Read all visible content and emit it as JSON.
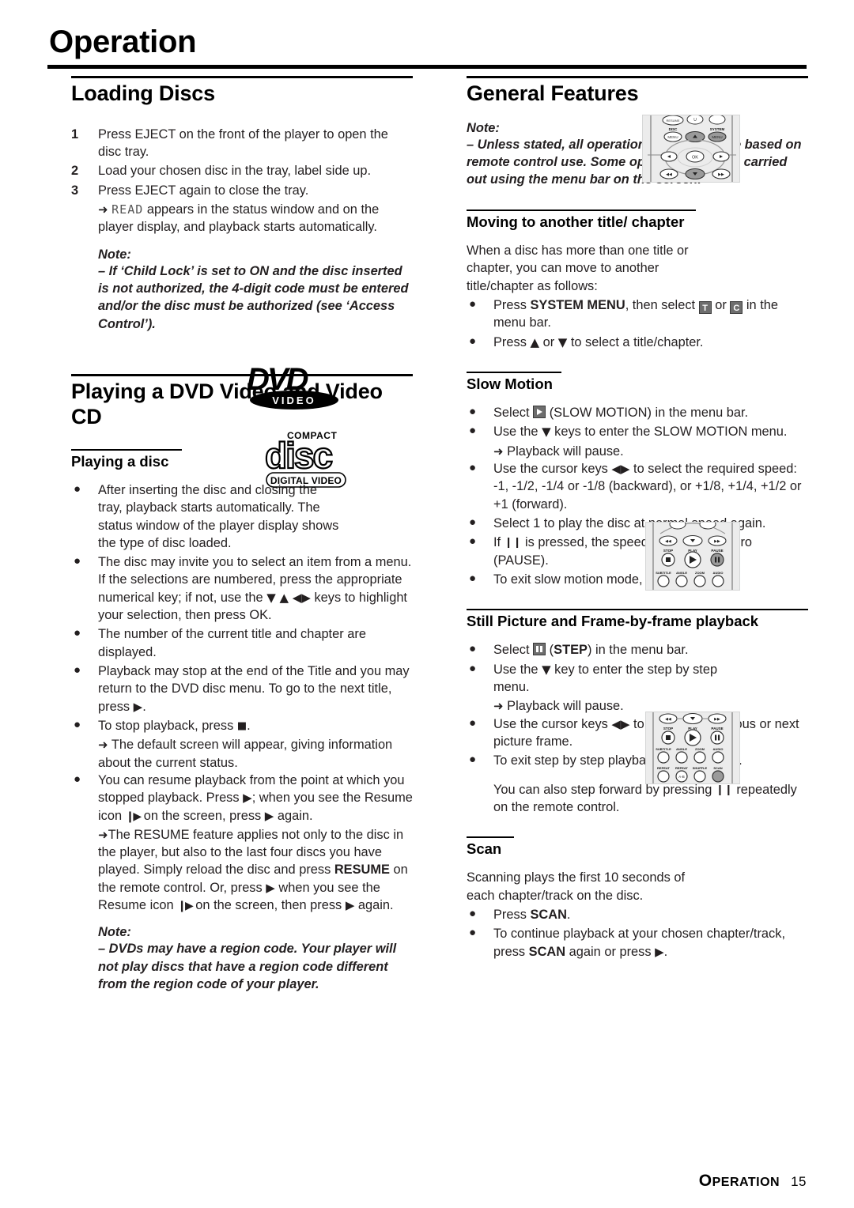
{
  "page": {
    "title": "Operation",
    "footer_section": "OPERATION",
    "footer_page": "15"
  },
  "left_column": {
    "loading_discs": {
      "heading": "Loading Discs",
      "steps": [
        {
          "num": "1",
          "text": "Press EJECT on the front of the player to open the disc tray."
        },
        {
          "num": "2",
          "text": "Load your chosen disc in the tray, label side up."
        },
        {
          "num": "3",
          "text": "Press EJECT again to close the tray."
        }
      ],
      "step3_result_prefix": "appears in the status window and on the player display, and playback starts automatically.",
      "lcd_text": "READ",
      "note_label": "Note:",
      "note_text": "–  If ‘Child Lock’ is set to ON and the disc inserted is not authorized, the 4-digit code must be entered and/or the disc must be authorized (see ‘Access Control’)."
    },
    "playing_dvd": {
      "heading": "Playing a DVD Video and Video CD",
      "subheading": "Playing a disc",
      "bullet1": "After inserting the disc and closing the tray, playback starts automatically. The status window of the player display shows the type of disc loaded.",
      "bullet2_a": "The disc may invite you to select an item from a menu. If the selections are numbered, press the appropriate numerical key; if not, use the",
      "bullet2_b": "keys to highlight your selection, then press OK.",
      "bullet3": "The number of the current title and chapter are displayed.",
      "bullet4_a": "Playback may stop at the end of the Title and you may return to the DVD disc menu. To go to the next title, press",
      "bullet5_a": "To stop playback, press",
      "bullet5_result": "The default screen will appear, giving information about the current status.",
      "bullet6_a": "You can resume playback from the point at which you stopped playback. Press",
      "bullet6_b": "; when you see the Resume icon",
      "bullet6_c": "on the screen, press",
      "bullet6_d": "again.",
      "bullet6_result_a": "The RESUME feature applies not only to the disc in the player, but also to the last four discs you have played. Simply reload the disc and press",
      "resume_bold": "RESUME",
      "bullet6_result_b": "on the remote control. Or, press",
      "bullet6_result_c": "when you see the Resume icon",
      "bullet6_result_d": "on the screen, then press",
      "bullet6_result_e": "again.",
      "note_label": "Note:",
      "note_text": "–  DVDs may have a region code. Your player will not play discs that have a region code different from the region code of your player."
    },
    "logos": {
      "dvd": "DVD",
      "dvd_sub": "VIDEO",
      "cd_top": "COMPACT",
      "cd_word": "disc",
      "cd_sub": "DIGITAL VIDEO"
    }
  },
  "right_column": {
    "general_features": {
      "heading": "General Features",
      "note_label": "Note:",
      "note_text": "–  Unless stated, all operations described are based on remote control use.  Some operations can be carried out using the menu bar on the screen."
    },
    "moving_title": {
      "subheading": "Moving to another title/ chapter",
      "intro": "When a disc has more than one title or chapter, you can move to another title/chapter as follows:",
      "bullet1_a": "Press",
      "bullet1_bold": "SYSTEM MENU",
      "bullet1_b": ", then select",
      "bullet1_icon_t": "T",
      "bullet1_c": "or",
      "bullet1_icon_c": "C",
      "bullet1_d": "in the menu bar.",
      "bullet2_a": "Press",
      "bullet2_b": "or",
      "bullet2_c": "to select a title/chapter."
    },
    "slow_motion": {
      "subheading": "Slow Motion",
      "bullet1_a": "Select",
      "bullet1_b": "(SLOW MOTION) in the menu bar.",
      "bullet2_a": "Use the",
      "bullet2_b": "keys to enter the SLOW MOTION menu.",
      "bullet2_result": "Playback will pause.",
      "bullet3_a": "Use the cursor keys",
      "bullet3_b": "to select the required speed: -1, -1/2, -1/4 or -1/8 (backward), or +1/8, +1/4, +1/2 or +1 (forward).",
      "bullet4": "Select 1 to play the disc at normal speed again.",
      "bullet5_a": "If",
      "bullet5_b": "is pressed, the speed will be set to zero (PAUSE).",
      "bullet6_a": "To exit slow motion mode, press",
      "bullet6_b": "or",
      "bullet6_c": "."
    },
    "still_picture": {
      "subheading": "Still Picture and Frame-by-frame playback",
      "bullet1_a": "Select",
      "bullet1_bold": "STEP",
      "bullet1_b": ") in the menu bar.",
      "bullet2_a": "Use the",
      "bullet2_b": "key to enter the step by step menu.",
      "bullet2_result": "Playback will pause.",
      "bullet3_a": "Use the cursor keys",
      "bullet3_b": "to select the previous or next picture frame.",
      "bullet4_a": "To exit step by step playback, press",
      "bullet4_b": "or",
      "bullet4_c": ".",
      "para_a": "You can also step forward by pressing",
      "para_b": "repeatedly on the remote control."
    },
    "scan": {
      "subheading": "Scan",
      "intro": "Scanning plays the first 10 seconds of each chapter/track on the disc.",
      "bullet1_a": "Press",
      "bullet1_bold": "SCAN",
      "bullet1_b": ".",
      "bullet2_a": "To continue playback at your chosen chapter/track, press",
      "bullet2_bold": "SCAN",
      "bullet2_b": "again or press",
      "bullet2_c": "."
    }
  },
  "remote_images": {
    "remote_navigation": {
      "labels": [
        "RESUME",
        "DISC",
        "MENU",
        "SYSTEM",
        "MENU",
        "OK"
      ],
      "highlight_color": "#9a9a9a"
    },
    "remote_step": {
      "labels": [
        "STOP",
        "PLAY",
        "PAUSE",
        "SUBTITLE",
        "ANGLE",
        "ZOOM",
        "AUDIO"
      ],
      "highlight_color": "#9a9a9a"
    },
    "remote_scan": {
      "labels": [
        "STOP",
        "PLAY",
        "PAUSE",
        "SUBTITLE",
        "ANGLE",
        "ZOOM",
        "AUDIO",
        "REPEAT",
        "REPEAT",
        "SHUFFLE",
        "SCAN"
      ],
      "highlight_color": "#9a9a9a"
    }
  }
}
